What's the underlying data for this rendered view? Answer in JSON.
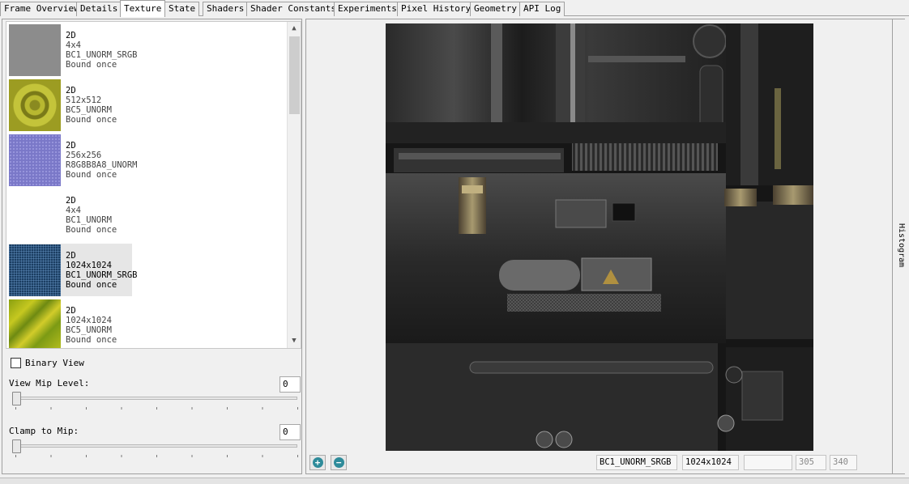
{
  "tabs": [
    {
      "label": "Frame Overview",
      "active": false
    },
    {
      "label": "Details",
      "active": false
    },
    {
      "label": "Texture",
      "active": true
    },
    {
      "label": "State",
      "active": false
    },
    {
      "label": "Shaders",
      "active": false
    },
    {
      "label": "Shader Constants",
      "active": false
    },
    {
      "label": "Experiments",
      "active": false
    },
    {
      "label": "Pixel History",
      "active": false
    },
    {
      "label": "Geometry",
      "active": false
    },
    {
      "label": "API Log",
      "active": false
    }
  ],
  "textures": [
    {
      "type": "2D",
      "size": "4x4",
      "format": "BC1_UNORM_SRGB",
      "binding": "Bound once",
      "thumb": "gray"
    },
    {
      "type": "2D",
      "size": "512x512",
      "format": "BC5_UNORM",
      "binding": "Bound once",
      "thumb": "normal-yellow"
    },
    {
      "type": "2D",
      "size": "256x256",
      "format": "R8G8B8A8_UNORM",
      "binding": "Bound once",
      "thumb": "purple-pattern"
    },
    {
      "type": "2D",
      "size": "4x4",
      "format": "BC1_UNORM",
      "binding": "Bound once",
      "thumb": "white"
    },
    {
      "type": "2D",
      "size": "1024x1024",
      "format": "BC1_UNORM_SRGB",
      "binding": "Bound once",
      "thumb": "blue-pattern",
      "selected": true
    },
    {
      "type": "2D",
      "size": "1024x1024",
      "format": "BC5_UNORM",
      "binding": "Bound once",
      "thumb": "normal-green"
    }
  ],
  "controls": {
    "binary_view_label": "Binary View",
    "binary_view_checked": false,
    "view_mip_label": "View Mip Level:",
    "view_mip_value": "0",
    "clamp_mip_label": "Clamp to Mip:",
    "clamp_mip_value": "0"
  },
  "viewer": {
    "histogram_label": "Histogram",
    "format": "BC1_UNORM_SRGB",
    "dimensions": "1024x1024",
    "pixel_value": "",
    "coord_x": "305",
    "coord_y": "340",
    "zoom_in_icon": "zoom-in-icon",
    "zoom_out_icon": "zoom-out-icon"
  },
  "colors": {
    "accent": "#2e8b9a",
    "panel_bg": "#f0f0f0",
    "texture_bg": "#151515"
  }
}
